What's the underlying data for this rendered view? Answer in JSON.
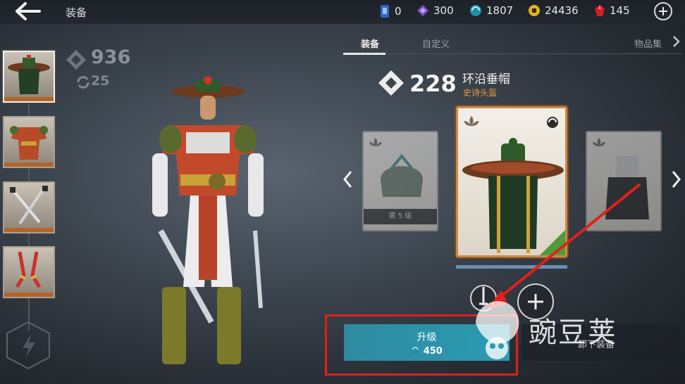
{
  "header": {
    "title": "装备",
    "back_icon": "back-arrow-icon",
    "currencies": [
      {
        "name": "phone-gem-icon",
        "value": "0",
        "color": "#3b79d8"
      },
      {
        "name": "purple-crystal-icon",
        "value": "300",
        "color": "#8a5fd6"
      },
      {
        "name": "teal-orb-icon",
        "value": "1807",
        "color": "#2bb6c9"
      },
      {
        "name": "gold-coin-icon",
        "value": "24436",
        "color": "#e8c22a"
      },
      {
        "name": "ruby-icon",
        "value": "145",
        "color": "#d8262a"
      }
    ],
    "add_icon": "plus-circle-icon"
  },
  "left_panel": {
    "power": "936",
    "refresh": "25",
    "slots": [
      "helmet",
      "armor",
      "weapons",
      "ranged"
    ]
  },
  "tabs": [
    {
      "label": "装备",
      "active": true
    },
    {
      "label": "自定义",
      "active": false
    },
    {
      "label": "物品集",
      "active": false
    }
  ],
  "item": {
    "power": "228",
    "name": "环沿垂帽",
    "rarity": "史诗头盔",
    "rarity_color": "#e39a3b",
    "left_card_level": "第 5 级"
  },
  "actions": {
    "upgrade_label": "升级",
    "upgrade_cost": "450",
    "unequip_label": "卸下装备"
  },
  "watermark": "豌豆荚"
}
